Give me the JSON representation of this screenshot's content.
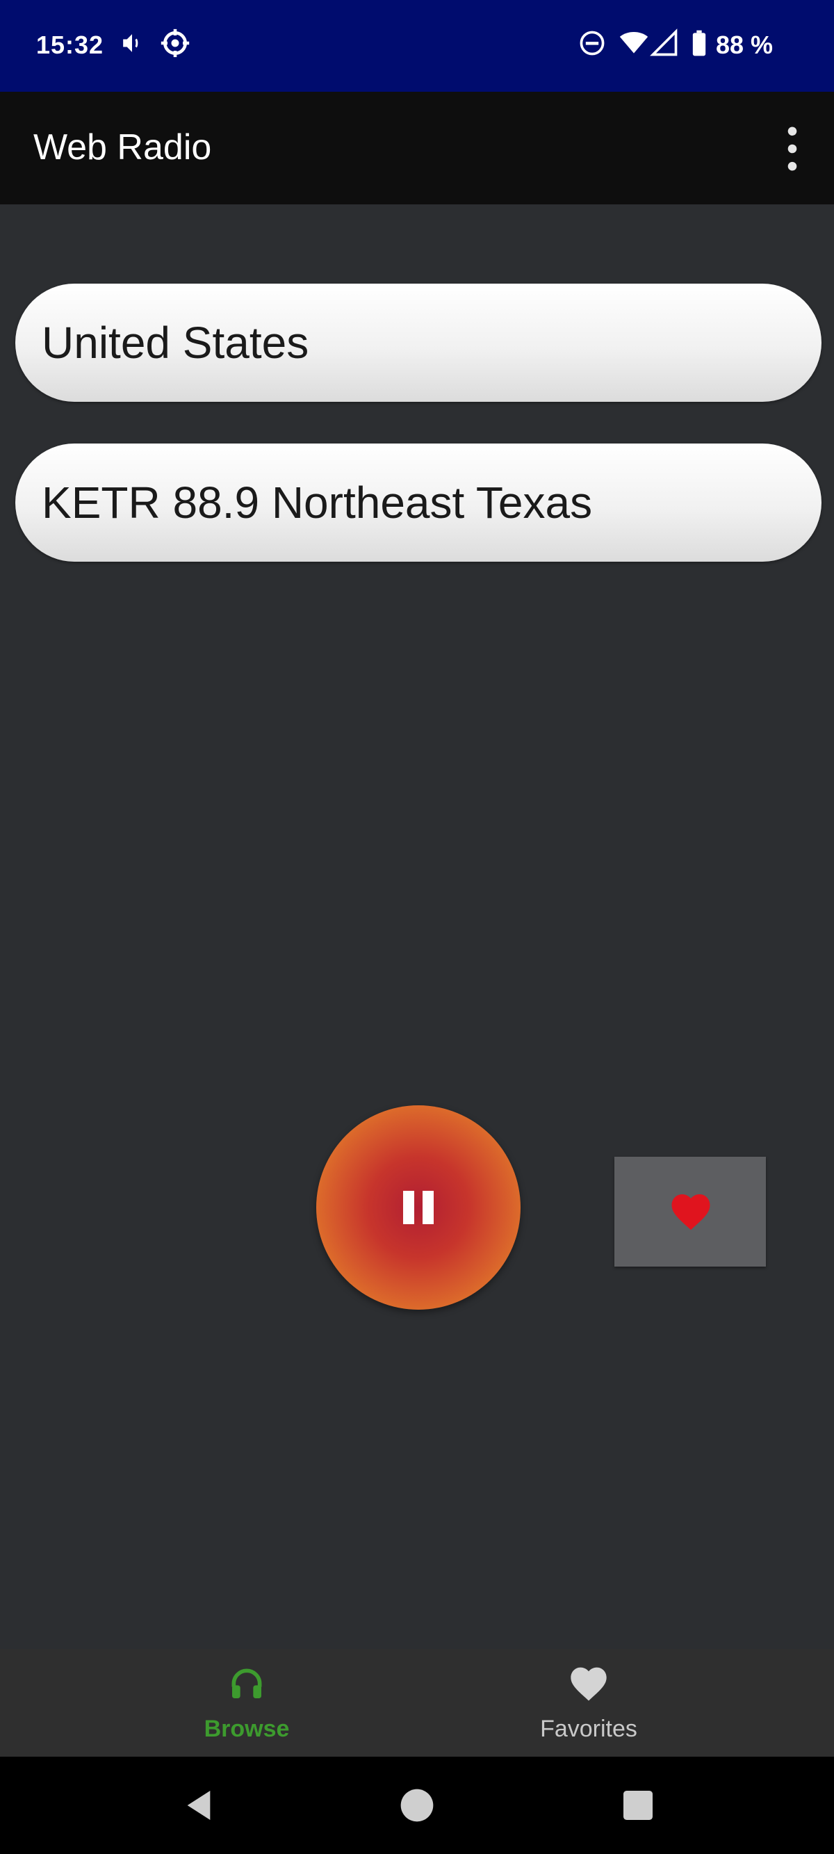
{
  "status_bar": {
    "time": "15:32",
    "battery": "88 %",
    "icons": [
      "volume-icon",
      "settings-gear-icon",
      "dnd-icon",
      "wifi-icon",
      "signal-icon",
      "battery-icon"
    ]
  },
  "app_bar": {
    "title": "Web Radio",
    "menu_icon": "overflow-menu-icon"
  },
  "selectors": {
    "country": "United States",
    "station": "KETR 88.9 Northeast Texas"
  },
  "player": {
    "state_icon": "pause-icon",
    "accent_colors": [
      "#b11e32",
      "#e88a28"
    ]
  },
  "favorite_button": {
    "icon": "heart-icon",
    "color": "#e0141e"
  },
  "bottom_nav": {
    "items": [
      {
        "label": "Browse",
        "icon": "headphones-icon",
        "active": true,
        "color": "#3d9b2e"
      },
      {
        "label": "Favorites",
        "icon": "heart-icon",
        "active": false,
        "color": "#c9c9c9"
      }
    ]
  },
  "system_nav": {
    "icons": [
      "back-icon",
      "home-icon",
      "recents-icon"
    ]
  }
}
